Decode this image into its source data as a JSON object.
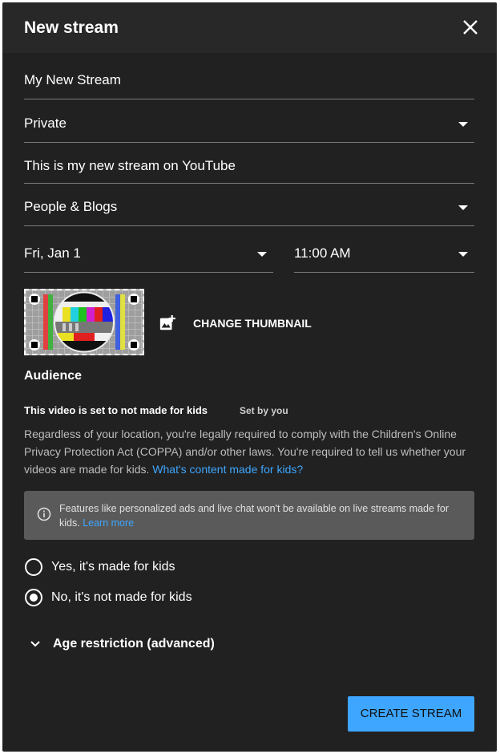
{
  "dialog": {
    "title": "New stream"
  },
  "form": {
    "title_value": "My New Stream",
    "visibility": "Private",
    "description": "This is my new stream on YouTube",
    "category": "People & Blogs",
    "date": "Fri, Jan 1",
    "time": "11:00 AM"
  },
  "thumbnail": {
    "change_label": "CHANGE THUMBNAIL"
  },
  "audience": {
    "heading": "Audience",
    "status": "This video is set to not made for kids",
    "set_by": "Set by you",
    "legal_text": "Regardless of your location, you're legally required to comply with the Children's Online Privacy Protection Act (COPPA) and/or other laws. You're required to tell us whether your videos are made for kids. ",
    "legal_link": "What's content made for kids?",
    "info_text": "Features like personalized ads and live chat won't be available on live streams made for kids. ",
    "info_link": "Learn more",
    "options": [
      {
        "label": "Yes, it's made for kids",
        "checked": false
      },
      {
        "label": "No, it's not made for kids",
        "checked": true
      }
    ],
    "age_restriction": "Age restriction (advanced)"
  },
  "actions": {
    "create_label": "CREATE STREAM"
  },
  "colors": {
    "accent": "#3ea6ff",
    "background": "#212121",
    "header": "#282828",
    "info_box": "#5a5a5a"
  }
}
